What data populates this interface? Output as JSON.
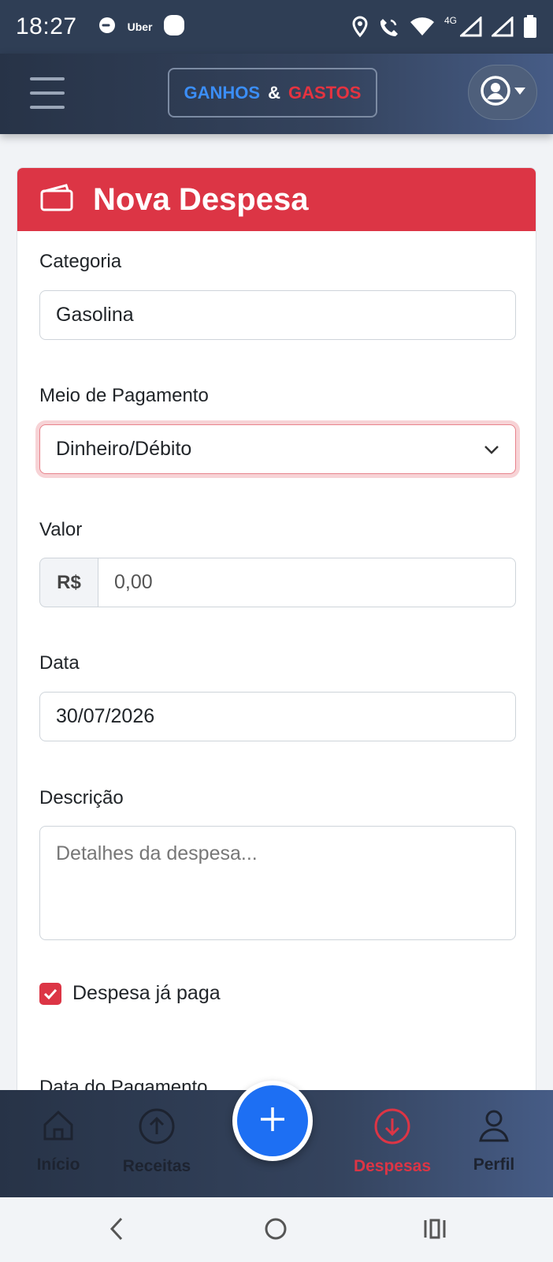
{
  "status_bar": {
    "time": "18:27",
    "uber_label": "Uber",
    "network_label": "4G",
    "icons": [
      "chat-bubble-icon",
      "uber-icon",
      "app-icon",
      "location-icon",
      "call-wifi-icon",
      "wifi-icon",
      "signal-icon",
      "signal-icon",
      "battery-icon"
    ]
  },
  "header": {
    "brand_ganhos": "GANHOS",
    "brand_amp": "&",
    "brand_gastos": "GASTOS",
    "menu_icon": "hamburger-icon",
    "profile_icon": "user-circle-icon"
  },
  "card": {
    "title": "Nova Despesa",
    "title_icon": "wallet-icon",
    "accent_color": "#dc3545"
  },
  "form": {
    "categoria_label": "Categoria",
    "categoria_value": "Gasolina",
    "meio_label": "Meio de Pagamento",
    "meio_value": "Dinheiro/Débito",
    "valor_label": "Valor",
    "valor_prefix": "R$",
    "valor_placeholder": "0,00",
    "data_label": "Data",
    "data_value": "30/07/2026",
    "descricao_label": "Descrição",
    "descricao_placeholder": "Detalhes da despesa...",
    "paga_label": "Despesa já paga",
    "paga_checked": true,
    "data_pagamento_label": "Data do Pagamento"
  },
  "bottom_nav": {
    "items": [
      {
        "label": "Início",
        "icon": "home-icon",
        "active": false
      },
      {
        "label": "Receitas",
        "icon": "arrow-up-circle-icon",
        "active": false
      },
      {
        "label": "Despesas",
        "icon": "arrow-down-circle-icon",
        "active": true
      },
      {
        "label": "Perfil",
        "icon": "person-icon",
        "active": false
      }
    ],
    "fab_icon": "plus-icon"
  },
  "colors": {
    "primary": "#1d6ff3",
    "danger": "#dc3545",
    "header_bg": "#2f3e55"
  }
}
